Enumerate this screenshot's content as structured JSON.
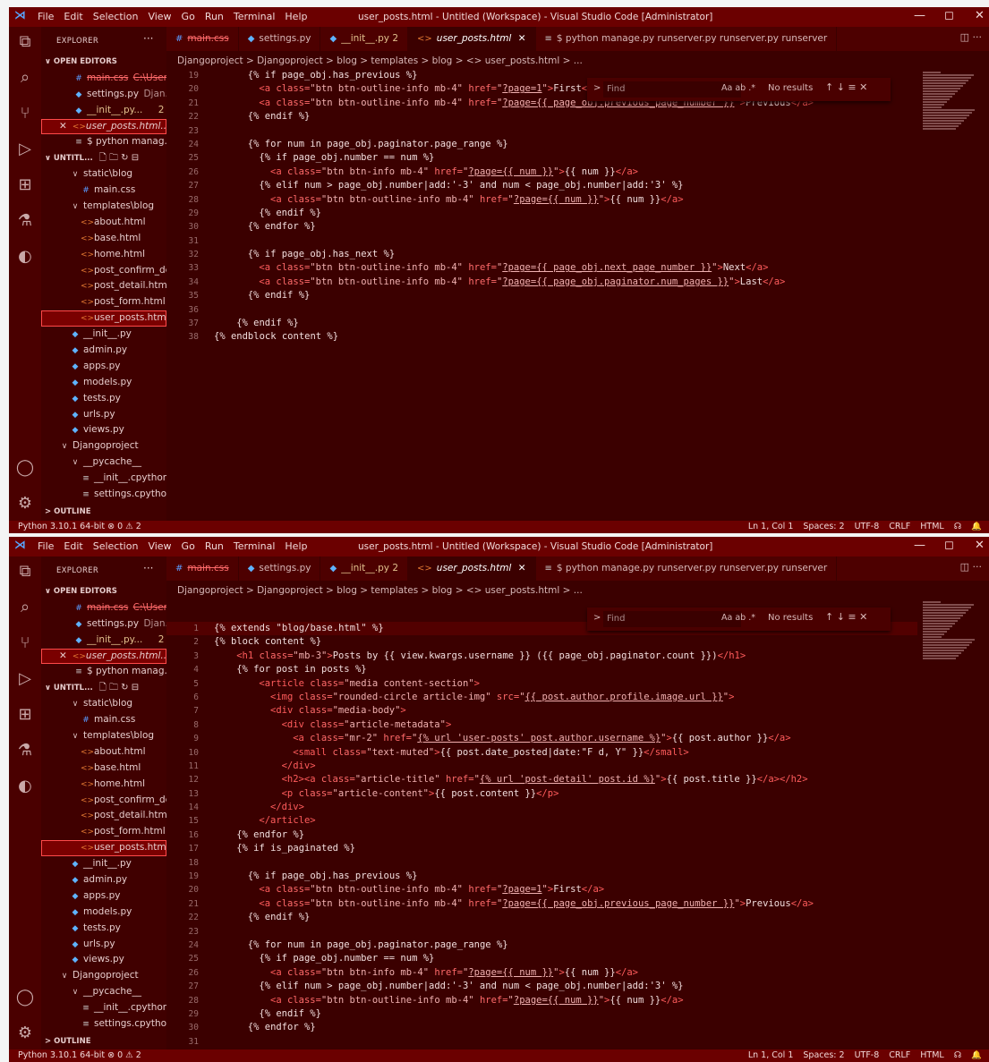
{
  "window": {
    "menu": [
      "File",
      "Edit",
      "Selection",
      "View",
      "Go",
      "Run",
      "Terminal",
      "Help"
    ],
    "title": "user_posts.html - Untitled (Workspace) - Visual Studio Code [Administrator]",
    "controls": {
      "minimize": "—",
      "maximize": "◻",
      "close": "✕"
    }
  },
  "activity": [
    "files-icon",
    "search-icon",
    "source-control-icon",
    "run-debug-icon",
    "extensions-icon",
    "testing-icon",
    "edge-icon",
    "account-icon",
    "settings-gear-icon"
  ],
  "sidebar": {
    "title": "EXPLORER",
    "dots": "···",
    "open_editors_label": "OPEN EDITORS",
    "open_editors": [
      {
        "icon": "css",
        "name": "main.css",
        "detail": "C:\\Users...",
        "strike": true
      },
      {
        "icon": "py",
        "name": "settings.py",
        "detail": "Djan..."
      },
      {
        "icon": "py",
        "name": "__init__.py...",
        "detail": "2",
        "warn": true
      },
      {
        "icon": "html",
        "name": "user_posts.html...",
        "prefix": "✕",
        "italic": true,
        "selected": true
      },
      {
        "icon": "term",
        "name": "$ python manag..."
      }
    ],
    "workspace_label": "UNTITL...",
    "workspace_tools": "🗋 🗀 ↻ ⊟",
    "tree": [
      {
        "indent": 2,
        "icon": "chev",
        "glyph": "∨",
        "name": "static\\blog"
      },
      {
        "indent": 3,
        "icon": "css",
        "glyph": "#",
        "name": "main.css"
      },
      {
        "indent": 2,
        "icon": "chev",
        "glyph": "∨",
        "name": "templates\\blog"
      },
      {
        "indent": 3,
        "icon": "html",
        "glyph": "<>",
        "name": "about.html"
      },
      {
        "indent": 3,
        "icon": "html",
        "glyph": "<>",
        "name": "base.html"
      },
      {
        "indent": 3,
        "icon": "html",
        "glyph": "<>",
        "name": "home.html"
      },
      {
        "indent": 3,
        "icon": "html",
        "glyph": "<>",
        "name": "post_confirm_de..."
      },
      {
        "indent": 3,
        "icon": "html",
        "glyph": "<>",
        "name": "post_detail.html"
      },
      {
        "indent": 3,
        "icon": "html",
        "glyph": "<>",
        "name": "post_form.html"
      },
      {
        "indent": 3,
        "icon": "html",
        "glyph": "<>",
        "name": "user_posts.html",
        "selected": true
      },
      {
        "indent": 2,
        "icon": "py",
        "glyph": "◆",
        "name": "__init__.py"
      },
      {
        "indent": 2,
        "icon": "py",
        "glyph": "◆",
        "name": "admin.py"
      },
      {
        "indent": 2,
        "icon": "py",
        "glyph": "◆",
        "name": "apps.py"
      },
      {
        "indent": 2,
        "icon": "py",
        "glyph": "◆",
        "name": "models.py"
      },
      {
        "indent": 2,
        "icon": "py",
        "glyph": "◆",
        "name": "tests.py"
      },
      {
        "indent": 2,
        "icon": "py",
        "glyph": "◆",
        "name": "urls.py"
      },
      {
        "indent": 2,
        "icon": "py",
        "glyph": "◆",
        "name": "views.py"
      },
      {
        "indent": 1,
        "icon": "chev",
        "glyph": "∨",
        "name": "Djangoproject"
      },
      {
        "indent": 2,
        "icon": "chev",
        "glyph": "∨",
        "name": "__pycache__"
      },
      {
        "indent": 3,
        "icon": "term",
        "glyph": "≡",
        "name": "__init__.cpython-..."
      },
      {
        "indent": 3,
        "icon": "term",
        "glyph": "≡",
        "name": "settings.cpython..."
      }
    ],
    "outline_label": "OUTLINE"
  },
  "tabs": [
    {
      "icon": "#",
      "kind": "css",
      "label": "main.css",
      "strike": true
    },
    {
      "icon": "◆",
      "kind": "py",
      "label": "settings.py"
    },
    {
      "icon": "◆",
      "kind": "py",
      "label": "__init__.py 2",
      "warn": true
    },
    {
      "icon": "<>",
      "kind": "html",
      "label": "user_posts.html",
      "active": true,
      "close": "✕"
    },
    {
      "icon": "≡",
      "kind": "term",
      "label": "$ python manage.py runserver.py runserver.py runserver"
    }
  ],
  "tab_end": "◫ ···",
  "breadcrumb": "Djangoproject > Djangoproject > blog > templates > blog > <> user_posts.html > ...",
  "find": {
    "chevron": ">",
    "placeholder": "Find",
    "options": "Aa  ab  .*",
    "results": "No results",
    "nav": "↑  ↓  ≡  ✕"
  },
  "code_lines": [
    {
      "n": 1,
      "i": 0,
      "h": "{% extends \"blog/base.html\" %}"
    },
    {
      "n": 2,
      "i": 0,
      "h": "{% block content %}"
    },
    {
      "n": 3,
      "i": 2,
      "h": "<span class='tg'>&lt;h1</span> <span class='at'>class=</span><span class='av'>\"mb-3\"</span><span class='tg'>&gt;</span>Posts by {{ view.kwargs.username }} ({{ page_obj.paginator.count }})<span class='tg'>&lt;/h1&gt;</span>"
    },
    {
      "n": 4,
      "i": 2,
      "h": "{% for post in posts %}"
    },
    {
      "n": 5,
      "i": 4,
      "h": "<span class='tg'>&lt;article</span> <span class='at'>class=</span><span class='av'>\"media content-section\"</span><span class='tg'>&gt;</span>"
    },
    {
      "n": 6,
      "i": 5,
      "h": "<span class='tg'>&lt;img</span> <span class='at'>class=</span><span class='av'>\"rounded-circle article-img\"</span> <span class='at'>src=</span><span class='av'>\"<span class='lk'>{{ post.author.profile.image.url }}</span>\"</span><span class='tg'>&gt;</span>"
    },
    {
      "n": 7,
      "i": 5,
      "h": "<span class='tg'>&lt;div</span> <span class='at'>class=</span><span class='av'>\"media-body\"</span><span class='tg'>&gt;</span>"
    },
    {
      "n": 8,
      "i": 6,
      "h": "<span class='tg'>&lt;div</span> <span class='at'>class=</span><span class='av'>\"article-metadata\"</span><span class='tg'>&gt;</span>"
    },
    {
      "n": 9,
      "i": 7,
      "h": "<span class='tg'>&lt;a</span> <span class='at'>class=</span><span class='av'>\"mr-2\"</span> <span class='at'>href=</span><span class='av'>\"<span class='lk'>{% url 'user-posts' post.author.username %}</span>\"</span><span class='tg'>&gt;</span>{{ post.author }}<span class='tg'>&lt;/a&gt;</span>"
    },
    {
      "n": 10,
      "i": 7,
      "h": "<span class='tg'>&lt;small</span> <span class='at'>class=</span><span class='av'>\"text-muted\"</span><span class='tg'>&gt;</span>{{ post.date_posted|date:\"F d, Y\" }}<span class='tg'>&lt;/small&gt;</span>"
    },
    {
      "n": 11,
      "i": 6,
      "h": "<span class='tg'>&lt;/div&gt;</span>"
    },
    {
      "n": 12,
      "i": 6,
      "h": "<span class='tg'>&lt;h2&gt;&lt;a</span> <span class='at'>class=</span><span class='av'>\"article-title\"</span> <span class='at'>href=</span><span class='av'>\"<span class='lk'>{% url 'post-detail' post.id %}</span>\"</span><span class='tg'>&gt;</span>{{ post.title }}<span class='tg'>&lt;/a&gt;&lt;/h2&gt;</span>"
    },
    {
      "n": 13,
      "i": 6,
      "h": "<span class='tg'>&lt;p</span> <span class='at'>class=</span><span class='av'>\"article-content\"</span><span class='tg'>&gt;</span>{{ post.content }}<span class='tg'>&lt;/p&gt;</span>"
    },
    {
      "n": 14,
      "i": 5,
      "h": "<span class='tg'>&lt;/div&gt;</span>"
    },
    {
      "n": 15,
      "i": 4,
      "h": "<span class='tg'>&lt;/article&gt;</span>"
    },
    {
      "n": 16,
      "i": 2,
      "h": "{% endfor %}"
    },
    {
      "n": 17,
      "i": 2,
      "h": "{% if is_paginated %}"
    },
    {
      "n": 18,
      "i": 0,
      "h": ""
    },
    {
      "n": 19,
      "i": 3,
      "h": "{% if page_obj.has_previous %}"
    },
    {
      "n": 20,
      "i": 4,
      "h": "<span class='tg'>&lt;a</span> <span class='at'>class=</span><span class='av'>\"btn btn-outline-info mb-4\"</span> <span class='at'>href=</span><span class='av'>\"<span class='lk'>?page=1</span>\"</span><span class='tg'>&gt;</span>First<span class='tg'>&lt;/a&gt;</span>"
    },
    {
      "n": 21,
      "i": 4,
      "h": "<span class='tg'>&lt;a</span> <span class='at'>class=</span><span class='av'>\"btn btn-outline-info mb-4\"</span> <span class='at'>href=</span><span class='av'>\"<span class='lk'>?page={{ page_obj.previous_page_number }}</span>\"</span><span class='tg'>&gt;</span>Previous<span class='tg'>&lt;/a&gt;</span>"
    },
    {
      "n": 22,
      "i": 3,
      "h": "{% endif %}"
    },
    {
      "n": 23,
      "i": 0,
      "h": ""
    },
    {
      "n": 24,
      "i": 3,
      "h": "{% for num in page_obj.paginator.page_range %}"
    },
    {
      "n": 25,
      "i": 4,
      "h": "{% if page_obj.number == num %}"
    },
    {
      "n": 26,
      "i": 5,
      "h": "<span class='tg'>&lt;a</span> <span class='at'>class=</span><span class='av'>\"btn btn-info mb-4\"</span> <span class='at'>href=</span><span class='av'>\"<span class='lk'>?page={{ num }}</span>\"</span><span class='tg'>&gt;</span>{{ num }}<span class='tg'>&lt;/a&gt;</span>"
    },
    {
      "n": 27,
      "i": 4,
      "h": "{% elif num &gt; page_obj.number|add:'-3' and num &lt; page_obj.number|add:'3' %}"
    },
    {
      "n": 28,
      "i": 5,
      "h": "<span class='tg'>&lt;a</span> <span class='at'>class=</span><span class='av'>\"btn btn-outline-info mb-4\"</span> <span class='at'>href=</span><span class='av'>\"<span class='lk'>?page={{ num }}</span>\"</span><span class='tg'>&gt;</span>{{ num }}<span class='tg'>&lt;/a&gt;</span>"
    },
    {
      "n": 29,
      "i": 4,
      "h": "{% endif %}"
    },
    {
      "n": 30,
      "i": 3,
      "h": "{% endfor %}"
    },
    {
      "n": 31,
      "i": 0,
      "h": ""
    },
    {
      "n": 32,
      "i": 3,
      "h": "{% if page_obj.has_next %}"
    },
    {
      "n": 33,
      "i": 4,
      "h": "<span class='tg'>&lt;a</span> <span class='at'>class=</span><span class='av'>\"btn btn-outline-info mb-4\"</span> <span class='at'>href=</span><span class='av'>\"<span class='lk'>?page={{ page_obj.next_page_number }}</span>\"</span><span class='tg'>&gt;</span>Next<span class='tg'>&lt;/a&gt;</span>"
    },
    {
      "n": 34,
      "i": 4,
      "h": "<span class='tg'>&lt;a</span> <span class='at'>class=</span><span class='av'>\"btn btn-outline-info mb-4\"</span> <span class='at'>href=</span><span class='av'>\"<span class='lk'>?page={{ page_obj.paginator.num_pages }}</span>\"</span><span class='tg'>&gt;</span>Last<span class='tg'>&lt;/a&gt;</span>"
    },
    {
      "n": 35,
      "i": 3,
      "h": "{% endif %}"
    },
    {
      "n": 36,
      "i": 0,
      "h": ""
    },
    {
      "n": 37,
      "i": 2,
      "h": "{% endif %}"
    },
    {
      "n": 38,
      "i": 0,
      "h": "{% endblock content %}"
    }
  ],
  "panes": [
    {
      "first_line": 19,
      "last_line": 38,
      "current_line": 0
    },
    {
      "first_line": 1,
      "last_line": 31,
      "current_line": 1
    }
  ],
  "status": {
    "left": "Python 3.10.1 64-bit   ⊗ 0 ⚠ 2",
    "right": [
      "Ln 1, Col 1",
      "Spaces: 2",
      "UTF-8",
      "CRLF",
      "HTML",
      "☊",
      "🔔"
    ]
  },
  "colors": {
    "titlebar": "#6b0000",
    "editor_bg": "#3b0000",
    "accent_red": "#ff4a4a"
  }
}
